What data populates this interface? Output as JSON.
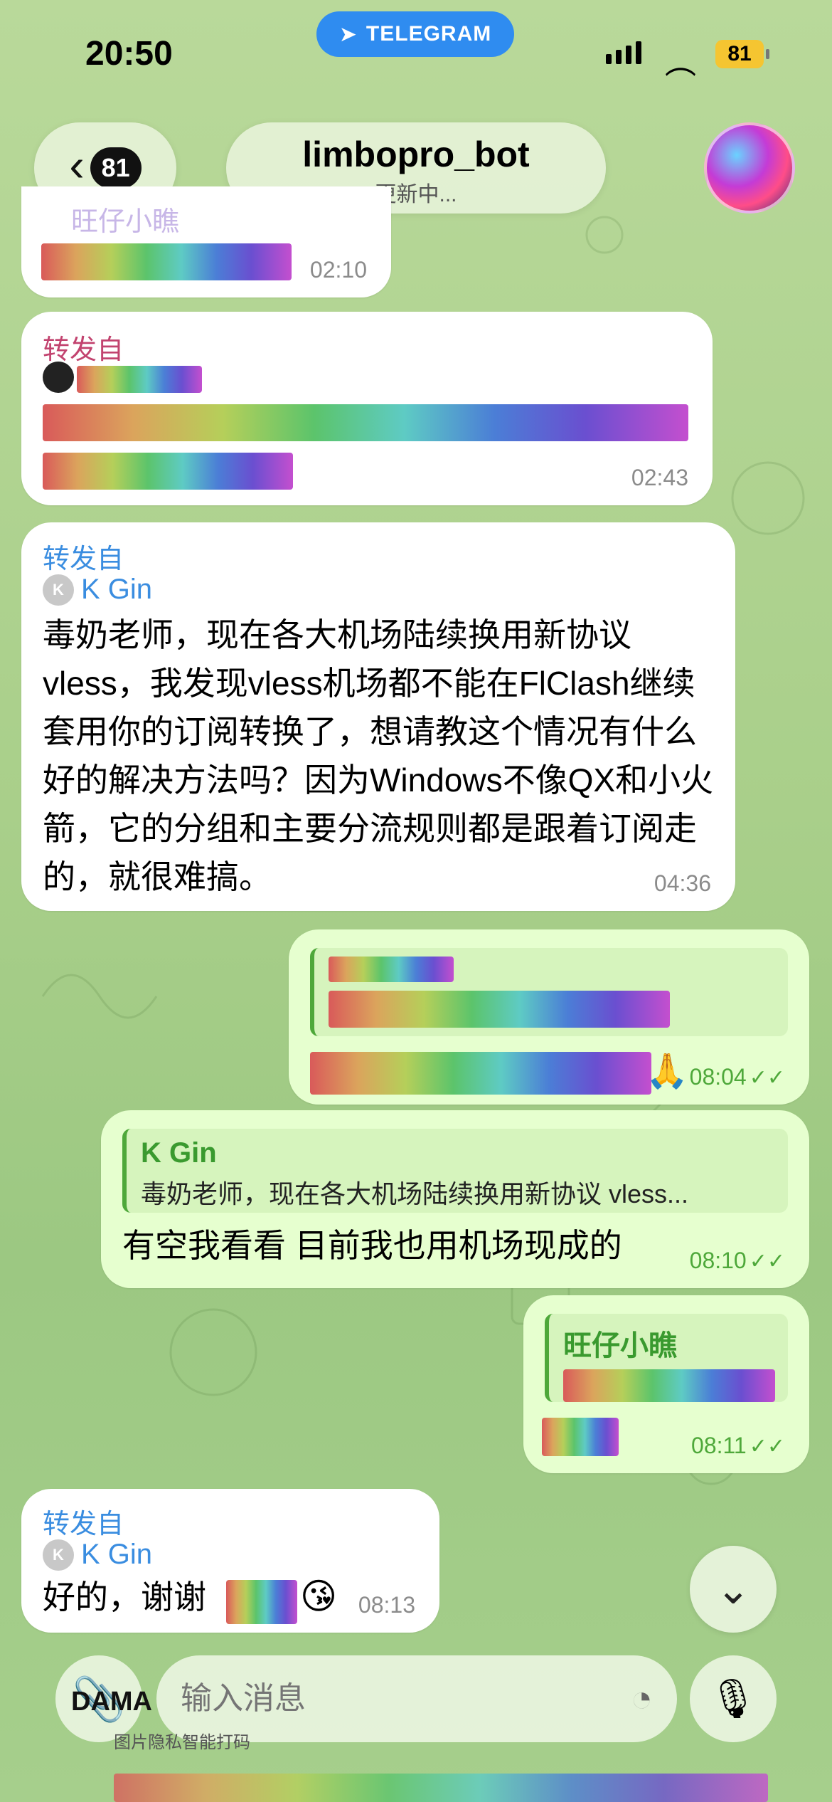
{
  "status_bar": {
    "time": "20:50",
    "telegram_label": "TELEGRAM",
    "battery": "81"
  },
  "header": {
    "back_count": "81",
    "title": "limbopro_bot",
    "subtitle": "更新中..."
  },
  "messages": [
    {
      "sender_name": "旺仔小瞧",
      "time": "02:10"
    },
    {
      "forward_label": "转发自",
      "time": "02:43"
    },
    {
      "forward_label": "转发自",
      "forward_from_initial": "K",
      "forward_from": "K Gin",
      "text": "毒奶老师，现在各大机场陆续换用新协议vless，我发现vless机场都不能在FlClash继续套用你的订阅转换了，想请教这个情况有什么好的解决方法吗？因为Windows不像QX和小火箭，它的分组和主要分流规则都是跟着订阅走的，就很难搞。",
      "time": "04:36"
    },
    {
      "emoji": "🙏",
      "time": "08:04"
    },
    {
      "quote_name": "K Gin",
      "quote_text": "毒奶老师，现在各大机场陆续换用新协议 vless...",
      "text": "有空我看看 目前我也用机场现成的",
      "time": "08:10"
    },
    {
      "quote_name": "旺仔小瞧",
      "time": "08:11"
    },
    {
      "forward_label": "转发自",
      "forward_from_initial": "K",
      "forward_from": "K Gin",
      "text": "好的，谢谢",
      "emoji": "😘",
      "time": "08:13"
    }
  ],
  "input": {
    "placeholder": "输入消息"
  },
  "watermark": {
    "brand": "DAMA",
    "caption": "图片隐私智能打码"
  },
  "colors": {
    "accent": "#3a8de0",
    "outgoing_bubble": "#e6ffcf",
    "telegram_pill": "#2f8cf0"
  }
}
